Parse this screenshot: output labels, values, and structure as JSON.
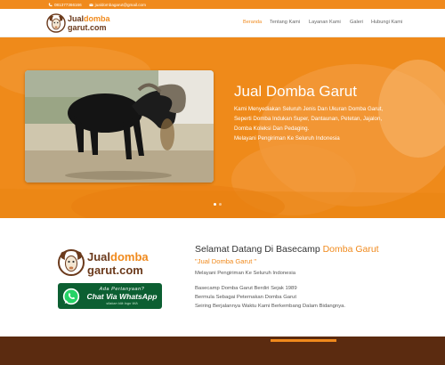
{
  "topbar": {
    "phone": "081377366166",
    "email": "jualdombagarut@gmail.com"
  },
  "header": {
    "logo_text": {
      "part1": "Jual",
      "part2": "domba",
      "part3": "garut.com"
    }
  },
  "nav": {
    "items": [
      {
        "label": "Beranda",
        "active": true
      },
      {
        "label": "Tentang Kami",
        "active": false
      },
      {
        "label": "Layanan Kami",
        "active": false
      },
      {
        "label": "Galeri",
        "active": false
      },
      {
        "label": "Hubungi Kami",
        "active": false
      }
    ]
  },
  "hero": {
    "title": "Jual Domba Garut",
    "lines": [
      "Kami Menyediakan Seluruh Jenis Dan Ukuran Domba Garut,",
      "Seperti Domba Indukan Super, Dantaunan, Petetan, Jajalon,",
      "Domba Koleksi Dan Pedaging.",
      "Melayani Pengiriman Ke Seluruh Indonesia"
    ],
    "slide_count": 2,
    "active_slide": 1
  },
  "welcome": {
    "title_prefix": "Selamat Datang Di Basecamp ",
    "title_highlight": "Domba Garut",
    "quote": "\"Jual Domba Garut \"",
    "line1": "Melayani Pengiriman Ke Seluruh Indonesia",
    "line2": "Basecamp Domba Garut Berdiri Sejak 1989",
    "line3": "Bermula Sebagai Peternakan Domba Garut",
    "line4": "Seiring Berjalannya Waktu Kami Berkembang Dalam Bidangnya."
  },
  "whatsapp": {
    "ask": "Ada Pertanyaan?",
    "main": "Chat Via WhatsApp",
    "sub": "silakan klik logo WA"
  },
  "colors": {
    "accent": "#f08a1d",
    "footer": "#5b2b10",
    "whatsapp": "#0c5f32"
  }
}
